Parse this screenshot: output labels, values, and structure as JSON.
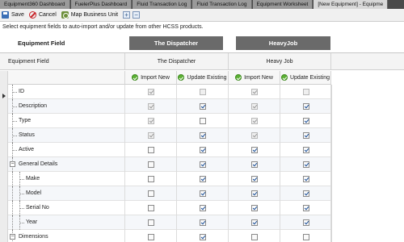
{
  "tabs": [
    {
      "label": "Equipment360 Dashboard",
      "active": false
    },
    {
      "label": "FuelerPlus Dashboard",
      "active": false
    },
    {
      "label": "Fluid Transaction Log",
      "active": false
    },
    {
      "label": "Fluid Transaction Log",
      "active": false
    },
    {
      "label": "Equipment Worksheet",
      "active": false
    },
    {
      "label": "[New Equipment] - Equipme",
      "active": true
    }
  ],
  "toolbar": {
    "save_label": "Save",
    "cancel_label": "Cancel",
    "map_label": "Map Business Unit",
    "expand_symbol": "+",
    "collapse_symbol": "−"
  },
  "instructions": "Select equipment fields to auto-import and/or update from other HCSS products.",
  "headers": {
    "equipment_field_title": "Equipment Field",
    "group_dispatcher": "The Dispatcher",
    "group_heavyjob": "HeavyJob",
    "col_equipment_field": "Equipment Field",
    "col_dispatcher": "The Dispatcher",
    "col_heavyjob": "Heavy Job",
    "import_new": "Import New",
    "update_existing": "Update Existing"
  },
  "rows": [
    {
      "label": "ID",
      "level": 0,
      "disp_import": true,
      "disp_update": false,
      "hj_import": true,
      "hj_update": false,
      "id_row": true
    },
    {
      "label": "Description",
      "level": 0,
      "disp_import": true,
      "disp_update": true,
      "hj_import": true,
      "hj_update": true
    },
    {
      "label": "Type",
      "level": 0,
      "disp_import": true,
      "disp_update": false,
      "hj_import": true,
      "hj_update": true
    },
    {
      "label": "Status",
      "level": 0,
      "disp_import": true,
      "disp_update": true,
      "hj_import": true,
      "hj_update": true
    },
    {
      "label": "Active",
      "level": 0,
      "disp_import": false,
      "disp_update": true,
      "hj_import": true,
      "hj_update": true
    },
    {
      "label": "General Details",
      "level": 0,
      "group": true,
      "disp_import": false,
      "disp_update": true,
      "hj_import": true,
      "hj_update": true
    },
    {
      "label": "Make",
      "level": 1,
      "disp_import": false,
      "disp_update": true,
      "hj_import": true,
      "hj_update": true
    },
    {
      "label": "Model",
      "level": 1,
      "disp_import": false,
      "disp_update": true,
      "hj_import": true,
      "hj_update": true
    },
    {
      "label": "Serial No",
      "level": 1,
      "disp_import": false,
      "disp_update": true,
      "hj_import": true,
      "hj_update": true
    },
    {
      "label": "Year",
      "level": 1,
      "disp_import": false,
      "disp_update": true,
      "hj_import": true,
      "hj_update": true
    },
    {
      "label": "Dimensions",
      "level": 0,
      "group": true,
      "disp_import": false,
      "disp_update": true,
      "hj_import": false,
      "hj_update": false
    }
  ]
}
